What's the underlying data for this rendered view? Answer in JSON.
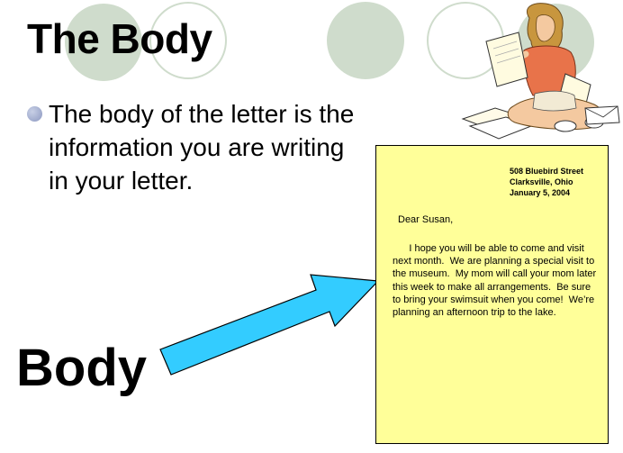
{
  "slide": {
    "title": "The Body",
    "bullet": "The body of the letter is the information you are writing in your letter.",
    "label": "Body"
  },
  "letter": {
    "address": [
      "508 Bluebird Street",
      "Clarksville, Ohio",
      "January 5, 2004"
    ],
    "greeting": "Dear Susan,",
    "body": "      I hope you will be able to come and visit next month.  We are planning a special visit to the museum.  My mom will call your mom later this week to make all arrangements.  Be sure to bring your swimsuit when you come!  We’re planning an afternoon trip to the lake."
  },
  "colors": {
    "letter_paper": "#ffff99",
    "arrow": "#33ccff",
    "decor_circle": "#cfdccc"
  },
  "icons": {
    "illustration": "girl-reading-letter-icon",
    "pointer": "arrow-icon"
  }
}
